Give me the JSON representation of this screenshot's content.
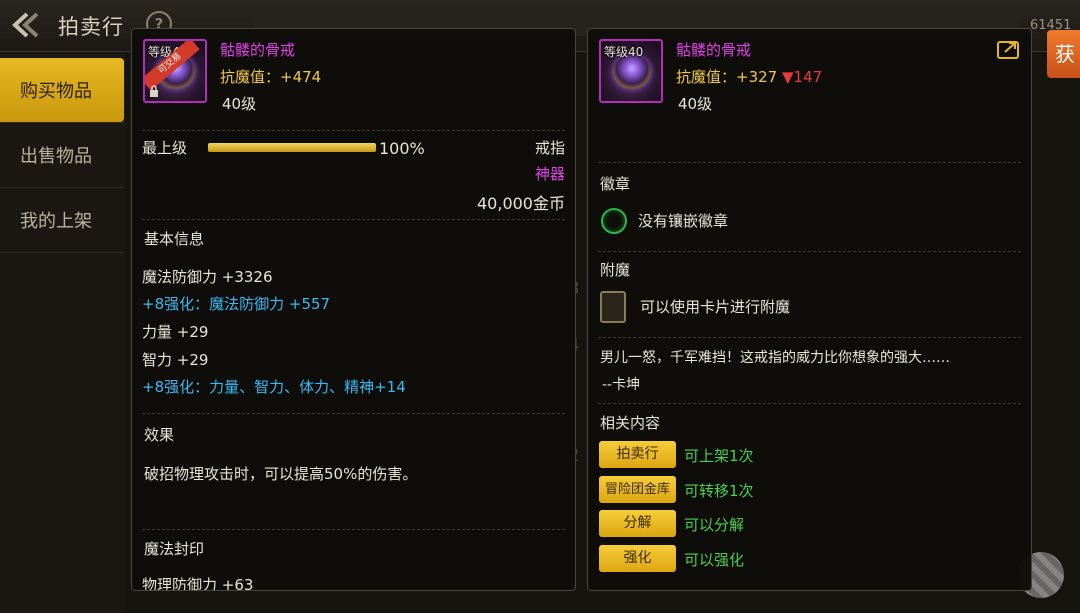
{
  "header": {
    "title": "拍卖行",
    "help_symbol": "?",
    "currency_partial": "61451",
    "right_button_partial": "获"
  },
  "sidebar": {
    "items": [
      {
        "label": "购买物品",
        "active": true
      },
      {
        "label": "出售物品",
        "active": false
      },
      {
        "label": "我的上架",
        "active": false
      }
    ]
  },
  "background": {
    "digits": [
      "8",
      "4",
      "2"
    ]
  },
  "left_panel": {
    "icon_level": "等级40",
    "badge": "可交易",
    "name": "骷髅的骨戒",
    "stat": "抗魔值：+474",
    "level": "40级",
    "upgrade_label": "最上级",
    "upgrade_percent": 100,
    "upgrade_text": "100%",
    "slot": "戒指",
    "rarity": "神器",
    "price": "40,000金币",
    "basic_title": "基本信息",
    "basic_lines": [
      {
        "text": "魔法防御力 +3326",
        "color": "white"
      },
      {
        "text": "+8强化：魔法防御力 +557",
        "color": "blue"
      },
      {
        "text": "力量 +29",
        "color": "white"
      },
      {
        "text": "智力 +29",
        "color": "white"
      },
      {
        "text": "+8强化：力量、智力、体力、精神+14",
        "color": "blue"
      }
    ],
    "effect_title": "效果",
    "effect_text": "破招物理攻击时，可以提高50%的伤害。",
    "seal_title": "魔法封印",
    "seal_partial": "物理防御力 +63"
  },
  "right_panel": {
    "icon_level": "等级40",
    "name": "骷髅的骨戒",
    "stat": "抗魔值：+327",
    "stat_diff": "▼147",
    "level": "40级",
    "emblem_title": "徽章",
    "emblem_text": "没有镶嵌徽章",
    "enchant_title": "附魔",
    "enchant_text": "可以使用卡片进行附魔",
    "quote_line1": "男儿一怒，千军难挡！这戒指的威力比你想象的强大……",
    "quote_line2": "--卡坤",
    "related_title": "相关内容",
    "related": [
      {
        "tag": "拍卖行",
        "note": "可上架1次"
      },
      {
        "tag": "冒险团金库",
        "note": "可转移1次"
      },
      {
        "tag": "分解",
        "note": "可以分解"
      },
      {
        "tag": "强化",
        "note": "可以强化"
      }
    ]
  },
  "colors": {
    "accent_gold": "#e6b820",
    "item_name": "#e040e8",
    "stat_gold": "#f0c84a",
    "enhance_blue": "#3ab8f2",
    "green_note": "#4ad04a",
    "down_red": "#e83a3a"
  },
  "icons": [
    "back-arrow-icon",
    "help-icon",
    "lock-icon",
    "share-icon",
    "emblem-slot-icon",
    "card-slot-icon"
  ]
}
